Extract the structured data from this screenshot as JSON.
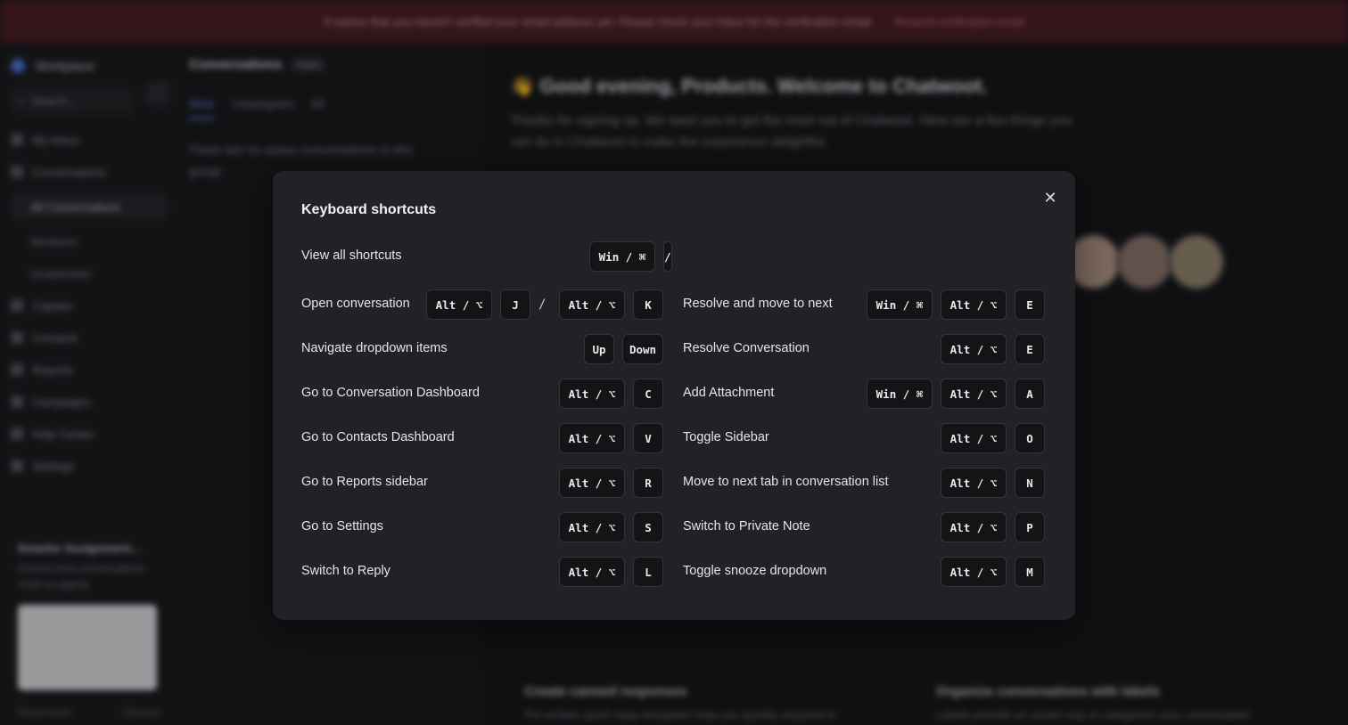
{
  "background": {
    "banner": {
      "message": "It seems that you haven't verified your email address yet. Please check your inbox for the verification email.",
      "action": "Resend verification email"
    },
    "sidebar": {
      "account": "Workplace",
      "search_placeholder": "Search...",
      "nav": [
        "My Inbox",
        "Conversations",
        "Captain",
        "Contacts",
        "Reports",
        "Campaigns",
        "Help Center",
        "Settings"
      ],
      "sub_nav": [
        "All Conversations",
        "Mentions",
        "Unattended"
      ],
      "card_title": "Smarter Assignment...",
      "card_desc": "Control how conversations route to agents",
      "card_links": [
        "Read more",
        "Dismiss"
      ]
    },
    "conversation_list": {
      "title": "Conversations",
      "badge": "Open",
      "tabs": [
        "Mine",
        "Unassigned",
        "All"
      ],
      "empty": "There are no active conversations in this group."
    },
    "main": {
      "greeting": "👋 Good evening, Products. Welcome to Chatwoot.",
      "subtitle": "Thanks for signing up. We want you to get the most out of Chatwoot. Here are a few things you can do in Chatwoot to make the experience delightful.",
      "tiles": [
        {
          "title": "Create canned responses",
          "desc": "Pre-written quick reply templates help you quickly respond to"
        },
        {
          "title": "Organize conversations with labels",
          "desc": "Labels provide an easier way to categorize your conversation"
        }
      ]
    }
  },
  "modal": {
    "title": "Keyboard shortcuts",
    "close_icon": "close-icon",
    "shortcuts": [
      {
        "label": "View all shortcuts",
        "keys": [
          "Win / ⌘",
          "/"
        ]
      },
      {
        "label": "Open conversation",
        "keys": [
          "Alt / ⌥",
          "J",
          "/",
          "Alt / ⌥",
          "K"
        ]
      },
      {
        "label": "Resolve and move to next",
        "keys": [
          "Win / ⌘",
          "Alt / ⌥",
          "E"
        ]
      },
      {
        "label": "Navigate dropdown items",
        "keys": [
          "Up",
          "Down"
        ]
      },
      {
        "label": "Resolve Conversation",
        "keys": [
          "Alt / ⌥",
          "E"
        ]
      },
      {
        "label": "Go to Conversation Dashboard",
        "keys": [
          "Alt / ⌥",
          "C"
        ]
      },
      {
        "label": "Add Attachment",
        "keys": [
          "Win / ⌘",
          "Alt / ⌥",
          "A"
        ]
      },
      {
        "label": "Go to Contacts Dashboard",
        "keys": [
          "Alt / ⌥",
          "V"
        ]
      },
      {
        "label": "Toggle Sidebar",
        "keys": [
          "Alt / ⌥",
          "O"
        ]
      },
      {
        "label": "Go to Reports sidebar",
        "keys": [
          "Alt / ⌥",
          "R"
        ]
      },
      {
        "label": "Move to next tab in conversation list",
        "keys": [
          "Alt / ⌥",
          "N"
        ]
      },
      {
        "label": "Go to Settings",
        "keys": [
          "Alt / ⌥",
          "S"
        ]
      },
      {
        "label": "Switch to Private Note",
        "keys": [
          "Alt / ⌥",
          "P"
        ]
      },
      {
        "label": "Switch to Reply",
        "keys": [
          "Alt / ⌥",
          "L"
        ]
      },
      {
        "label": "Toggle snooze dropdown",
        "keys": [
          "Alt / ⌥",
          "M"
        ]
      }
    ]
  }
}
